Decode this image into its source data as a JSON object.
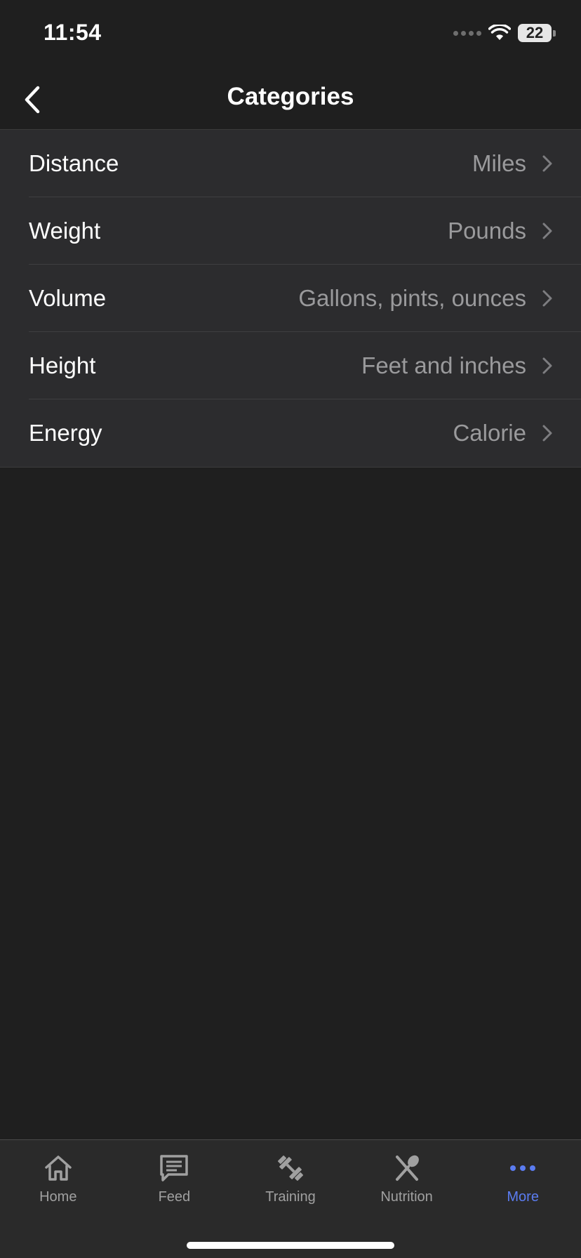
{
  "status_bar": {
    "time": "11:54",
    "battery": "22"
  },
  "nav": {
    "title": "Categories"
  },
  "categories": [
    {
      "label": "Distance",
      "value": "Miles"
    },
    {
      "label": "Weight",
      "value": "Pounds"
    },
    {
      "label": "Volume",
      "value": "Gallons, pints, ounces"
    },
    {
      "label": "Height",
      "value": "Feet and inches"
    },
    {
      "label": "Energy",
      "value": "Calorie"
    }
  ],
  "tab_bar": {
    "tabs": [
      {
        "label": "Home",
        "icon": "home-icon"
      },
      {
        "label": "Feed",
        "icon": "feed-icon"
      },
      {
        "label": "Training",
        "icon": "dumbbell-icon"
      },
      {
        "label": "Nutrition",
        "icon": "fork-spoon-icon"
      },
      {
        "label": "More",
        "icon": "more-dots-icon"
      }
    ],
    "active_index": 4
  },
  "colors": {
    "background": "#1f1f1f",
    "list_background": "#2c2c2e",
    "secondary_text": "#9a9a9c",
    "accent": "#5b7cf0",
    "tab_inactive": "#a0a0a0"
  }
}
